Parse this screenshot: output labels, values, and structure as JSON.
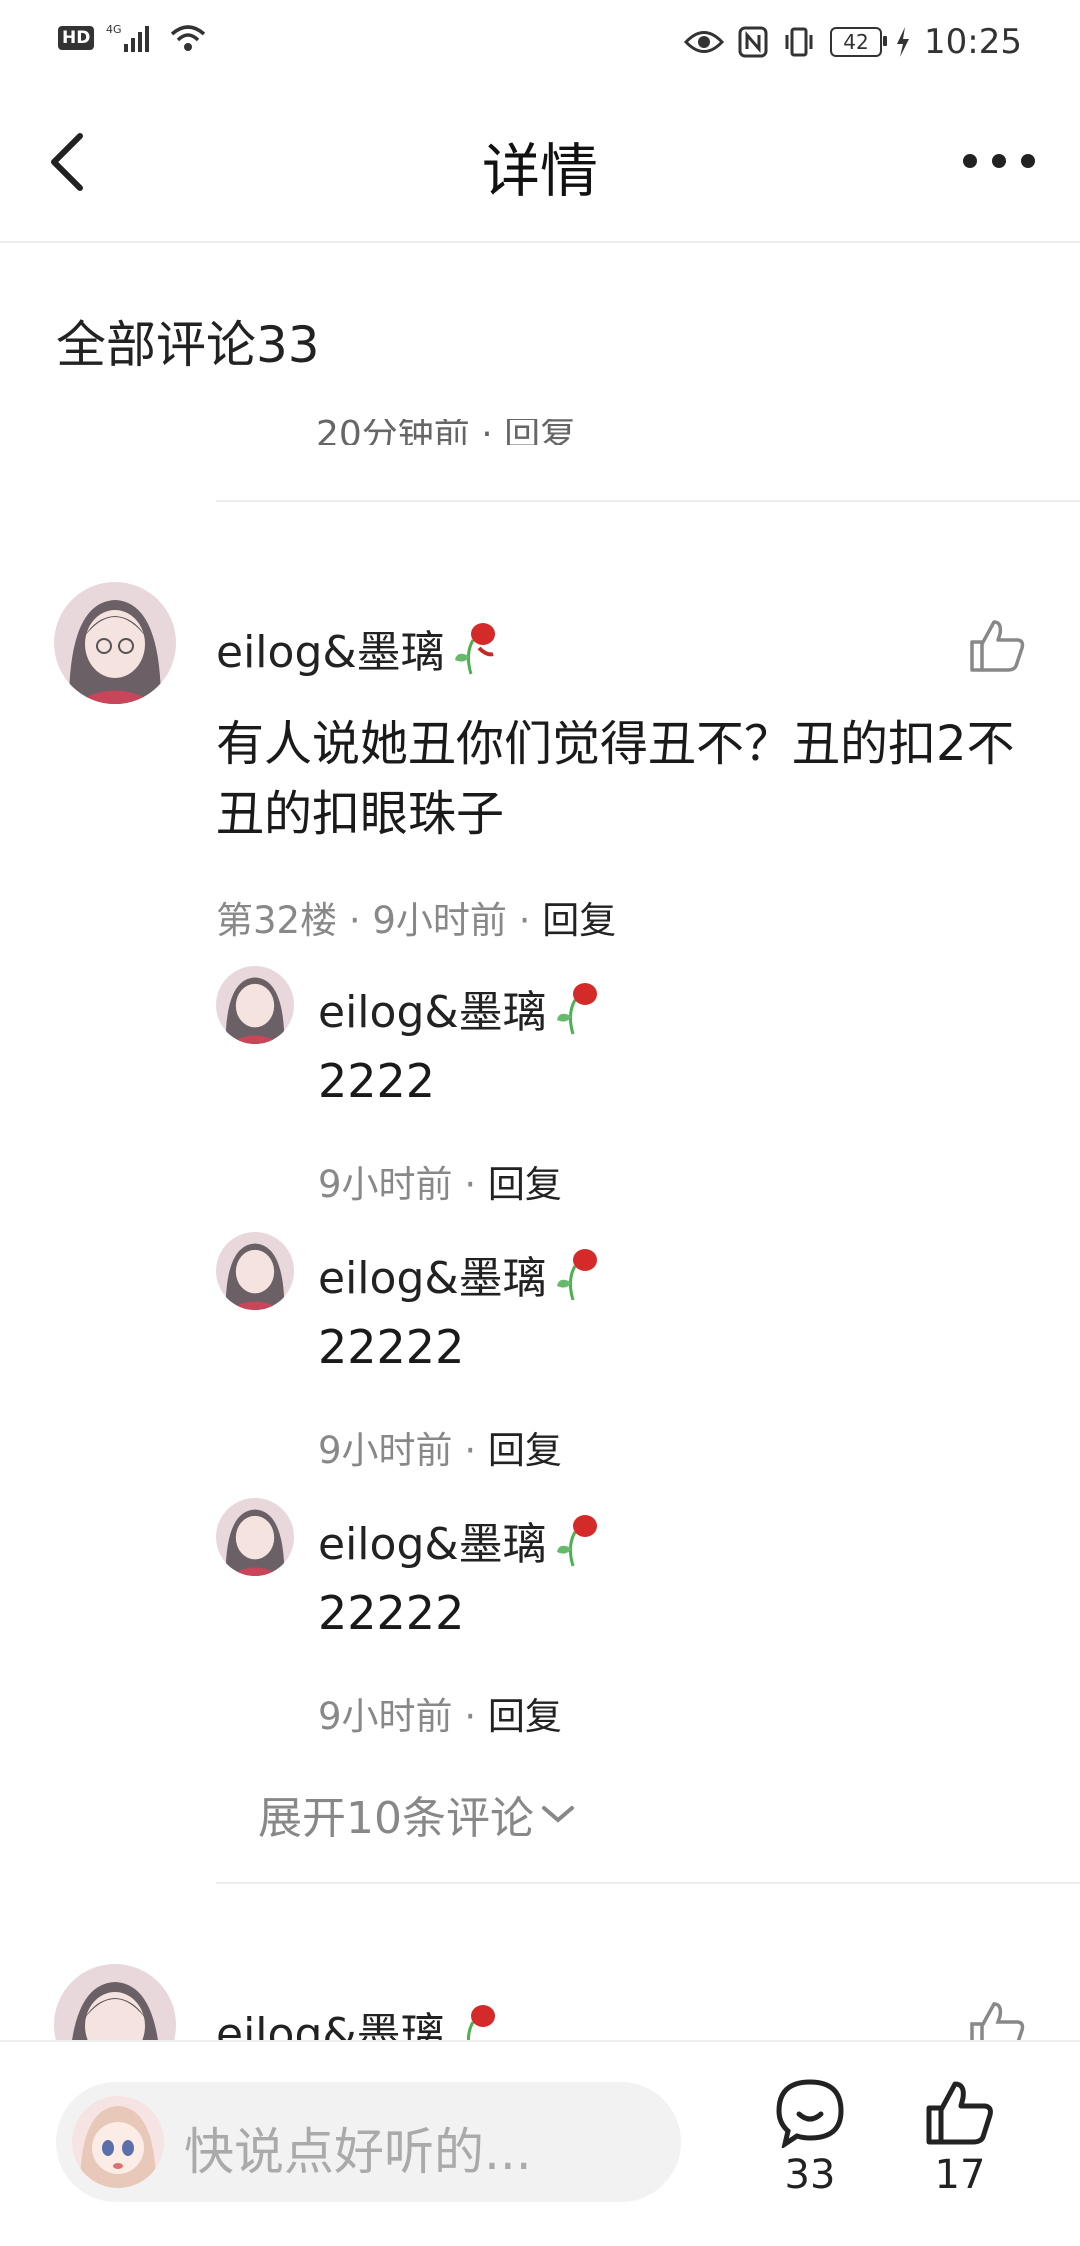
{
  "status_bar": {
    "time": "10:25",
    "battery": "42",
    "network": "4G",
    "hd": "HD"
  },
  "header": {
    "title": "详情"
  },
  "comments": {
    "section_title": "全部评论33",
    "cut_text": "20分钟前 · 回复",
    "main": {
      "username": "eilog&墨璃",
      "text": "有人说她丑你们觉得丑不？丑的扣2不丑的扣眼珠子",
      "floor": "第32楼",
      "time": "9小时前",
      "reply": "回复"
    },
    "replies": [
      {
        "username": "eilog&墨璃",
        "text": "2222",
        "time": "9小时前",
        "reply": "回复"
      },
      {
        "username": "eilog&墨璃",
        "text": "22222",
        "time": "9小时前",
        "reply": "回复"
      },
      {
        "username": "eilog&墨璃",
        "text": "22222",
        "time": "9小时前",
        "reply": "回复"
      }
    ],
    "expand_label": "展开10条评论",
    "next": {
      "username": "eilog&墨璃"
    }
  },
  "bottom_bar": {
    "input_placeholder": "快说点好听的...",
    "comment_count": "33",
    "like_count": "17"
  },
  "colors": {
    "accent_gray": "#888888",
    "text": "#1a1a1a",
    "divider": "#ececec",
    "rose": "#d42a2a"
  }
}
